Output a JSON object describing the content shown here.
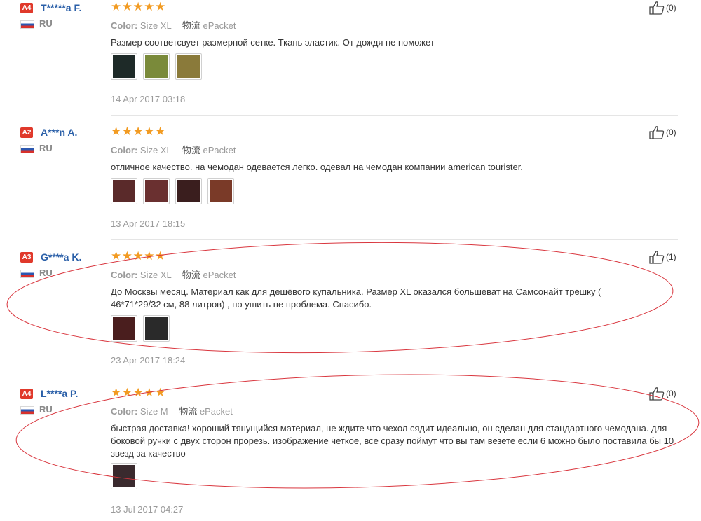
{
  "reviews": [
    {
      "badge": "A4",
      "name": "T*****a F.",
      "country": "RU",
      "stars": "★★★★★",
      "color_label": "Color:",
      "color_value": "Size XL",
      "ship_label": "物流",
      "ship_value": "ePacket",
      "text": "Размер соответсвует размерной сетке. Ткань эластик. От дождя не поможет",
      "date": "14 Apr 2017 03:18",
      "helpful": "(0)",
      "thumbs": [
        "#1e2a28",
        "#7a8a3a",
        "#8a7a3a"
      ]
    },
    {
      "badge": "A2",
      "name": "A***n A.",
      "country": "RU",
      "stars": "★★★★★",
      "color_label": "Color:",
      "color_value": "Size XL",
      "ship_label": "物流",
      "ship_value": "ePacket",
      "text": "отличное качество. на чемодан одевается легко. одевал на чемодан компании american tourister.",
      "date": "13 Apr 2017 18:15",
      "helpful": "(0)",
      "thumbs": [
        "#5a2a2a",
        "#6a3030",
        "#3a1e1e",
        "#7a3a28"
      ]
    },
    {
      "badge": "A3",
      "name": "G****a K.",
      "country": "RU",
      "stars": "★★★★★",
      "color_label": "Color:",
      "color_value": "Size XL",
      "ship_label": "物流",
      "ship_value": "ePacket",
      "text": "До Москвы месяц. Материал как для дешёвого купальника. Размер XL оказался большеват на Самсонайт трёшку ( 46*71*29/32 см, 88 литров) , но ушить не проблема. Спасибо.",
      "date": "23 Apr 2017 18:24",
      "helpful": "(1)",
      "thumbs": [
        "#4a1e1e",
        "#2a2a2a"
      ]
    },
    {
      "badge": "A4",
      "name": "L****a P.",
      "country": "RU",
      "stars": "★★★★★",
      "color_label": "Color:",
      "color_value": "Size M",
      "ship_label": "物流",
      "ship_value": "ePacket",
      "text": "быстрая доставка! хороший тянущийся материал, не ждите что чехол сядит идеально, он сделан для стандартного чемодана. для боковой ручки с двух сторон прорезь. изображение четкое, все сразу поймут что вы там везете если 6 можно было поставила бы 10 звезд за качество",
      "date": "13 Jul 2017 04:27",
      "helpful": "(0)",
      "thumbs": [
        "#3a2a2e"
      ]
    }
  ],
  "annotation_color": "#d9363e"
}
